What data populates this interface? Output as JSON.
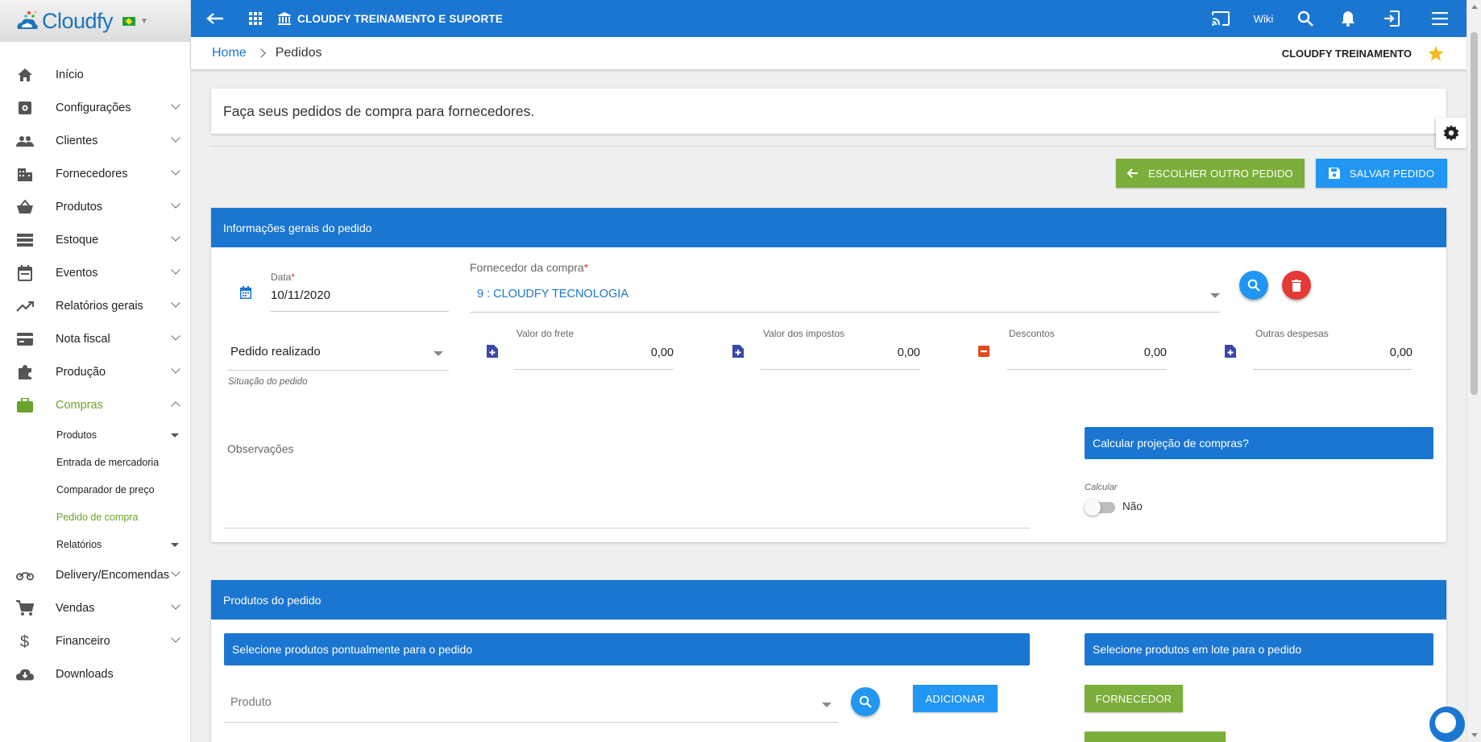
{
  "app": {
    "logo_text": "Cloudfy",
    "title": "CLOUDFY TREINAMENTO E SUPORTE",
    "wiki_label": "Wiki"
  },
  "breadcrumb": {
    "home": "Home",
    "current": "Pedidos",
    "company": "CLOUDFY TREINAMENTO"
  },
  "sidebar": {
    "items": [
      {
        "label": "Início",
        "icon": "home-icon"
      },
      {
        "label": "Configurações",
        "icon": "settings-icon"
      },
      {
        "label": "Clientes",
        "icon": "people-icon"
      },
      {
        "label": "Fornecedores",
        "icon": "building-icon"
      },
      {
        "label": "Produtos",
        "icon": "basket-icon"
      },
      {
        "label": "Estoque",
        "icon": "storage-icon"
      },
      {
        "label": "Eventos",
        "icon": "calendar-icon"
      },
      {
        "label": "Relatórios gerais",
        "icon": "trending-icon"
      },
      {
        "label": "Nota fiscal",
        "icon": "card-icon"
      },
      {
        "label": "Produção",
        "icon": "puzzle-icon"
      },
      {
        "label": "Compras",
        "icon": "briefcase-icon"
      },
      {
        "label": "Delivery/Encomendas",
        "icon": "motorbike-icon"
      },
      {
        "label": "Vendas",
        "icon": "cart-icon"
      },
      {
        "label": "Financeiro",
        "icon": "dollar-icon"
      },
      {
        "label": "Downloads",
        "icon": "cloud-download-icon"
      }
    ],
    "compras_sub": [
      "Produtos",
      "Entrada de mercadoria",
      "Comparador de preço",
      "Pedido de compra",
      "Relatórios"
    ]
  },
  "page": {
    "info": "Faça seus pedidos de compra para fornecedores.",
    "btn_escolher": "ESCOLHER OUTRO PEDIDO",
    "btn_salvar": "SALVAR PEDIDO"
  },
  "general": {
    "header": "Informações gerais do pedido",
    "data_label": "Data",
    "data_value": "10/11/2020",
    "fornecedor_label": "Fornecedor da compra",
    "fornecedor_value": "9 : CLOUDFY TECNOLOGIA",
    "situacao_value": "Pedido realizado",
    "situacao_label": "Situação do pedido",
    "frete_label": "Valor do frete",
    "frete_value": "0,00",
    "impostos_label": "Valor dos impostos",
    "impostos_value": "0,00",
    "descontos_label": "Descontos",
    "descontos_value": "0,00",
    "outras_label": "Outras despesas",
    "outras_value": "0,00",
    "observacoes_label": "Observações",
    "projecao_header": "Calcular projeção de compras?",
    "calcular_label": "Calcular",
    "calcular_value": "Não"
  },
  "products": {
    "header": "Produtos do pedido",
    "pontual_header": "Selecione produtos pontualmente para o pedido",
    "lote_header": "Selecione produtos em lote para o pedido",
    "produto_placeholder": "Produto",
    "btn_adicionar": "ADICIONAR",
    "btn_fornecedor": "FORNECEDOR"
  },
  "colors": {
    "primary": "#1b76d2",
    "green": "#7bae3a",
    "red": "#e53935",
    "accent_blue": "#2196f3"
  }
}
